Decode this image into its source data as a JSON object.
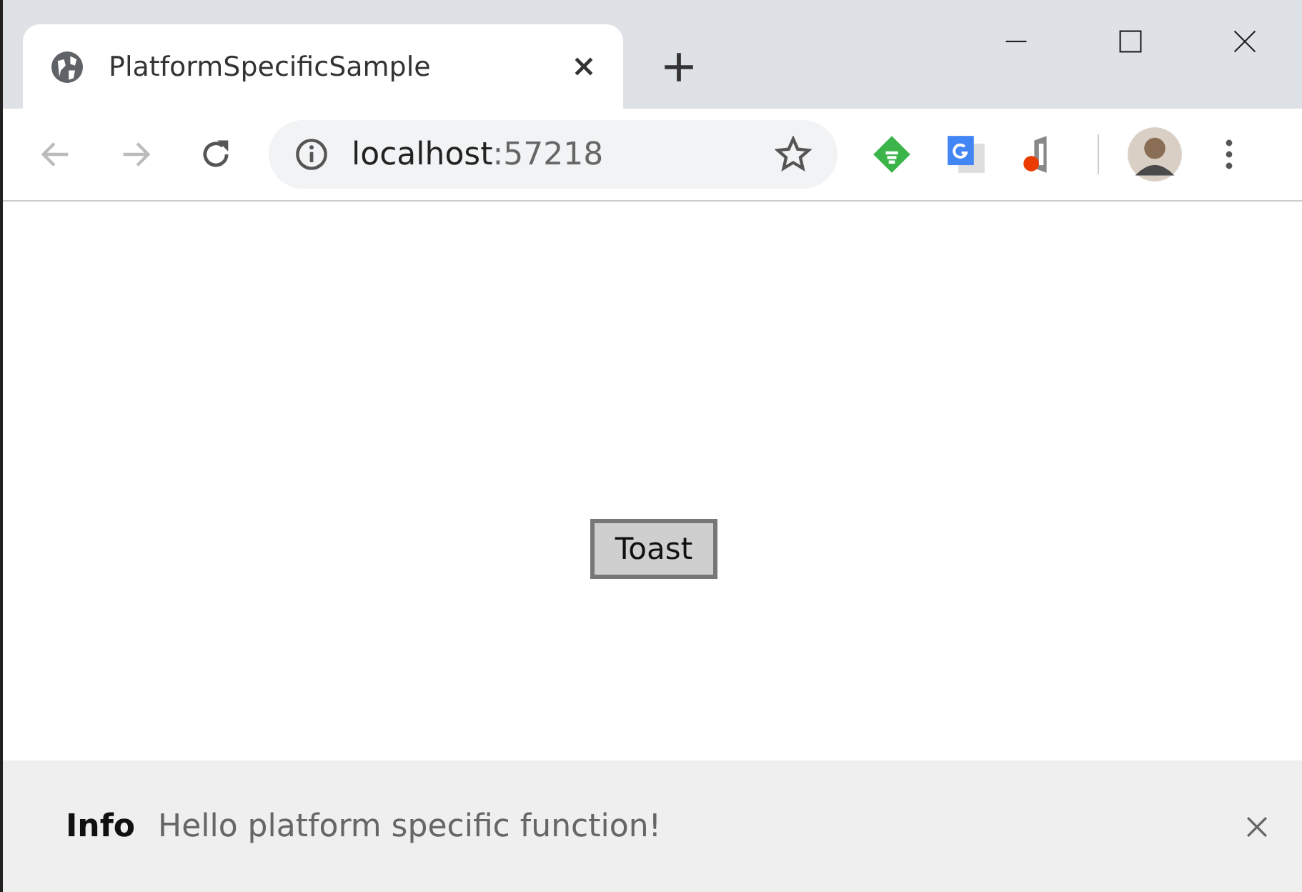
{
  "tab": {
    "title": "PlatformSpecificSample",
    "selected": true
  },
  "toolbar": {
    "back_disabled": true,
    "forward_disabled": true,
    "url_host": "localhost",
    "url_rest": ":57218"
  },
  "page": {
    "button": "Toast"
  },
  "notification": {
    "title": "Info",
    "message": "Hello platform specific function!"
  }
}
